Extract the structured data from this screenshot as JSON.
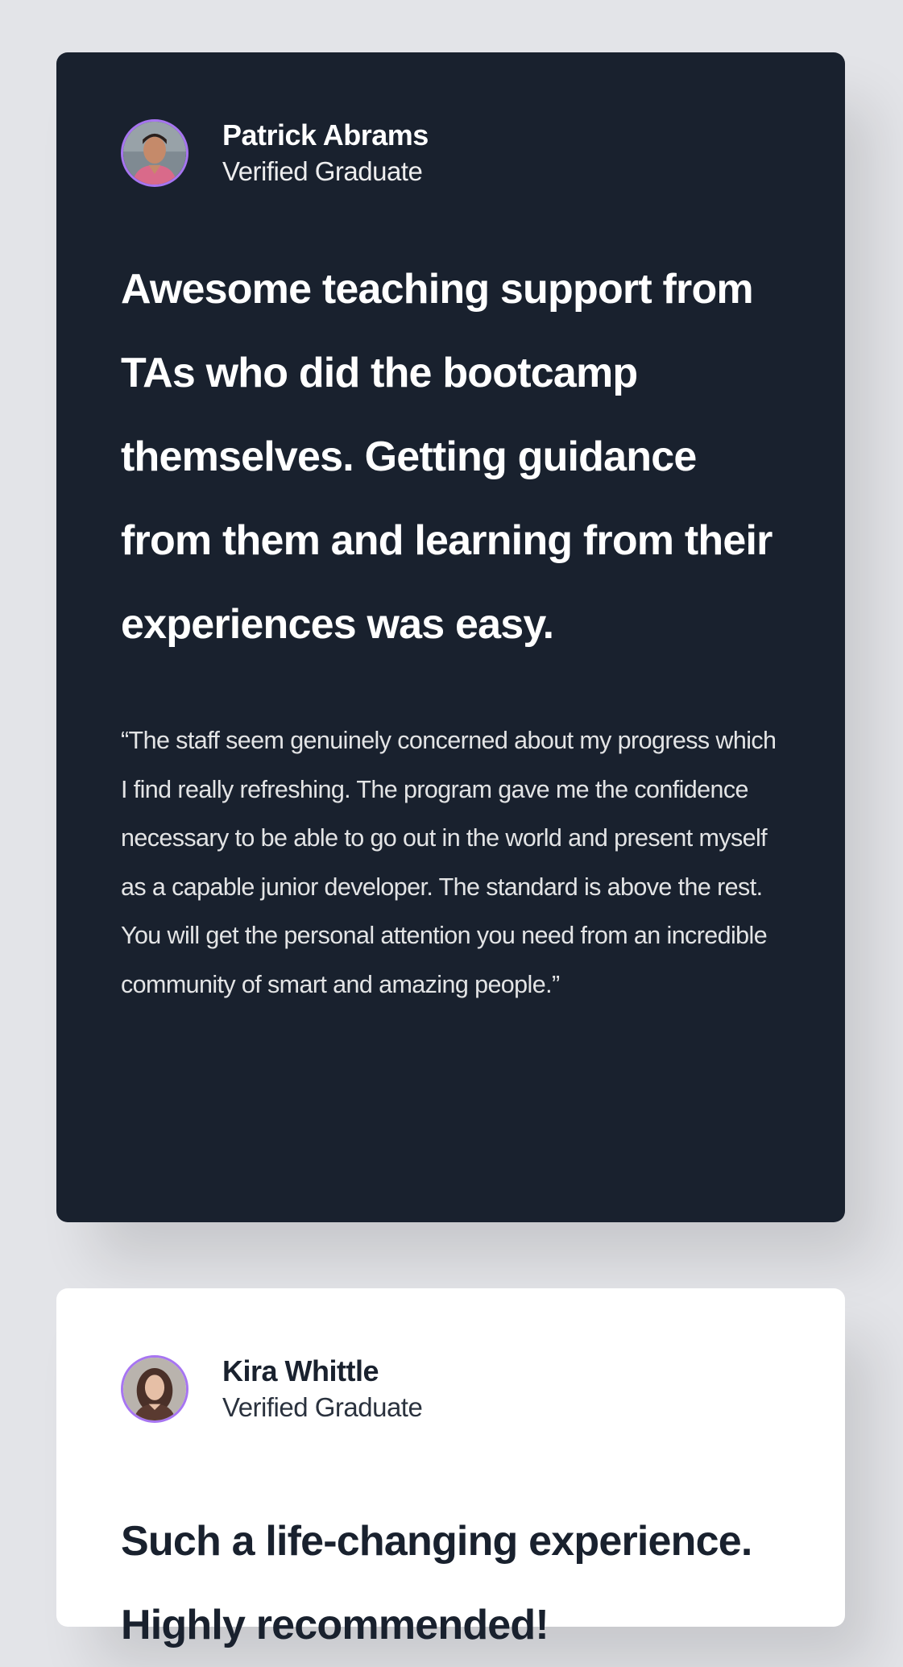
{
  "testimonials": [
    {
      "name": "Patrick Abrams",
      "status": "Verified Graduate",
      "headline": "Awesome teaching support from TAs who did the bootcamp themselves. Getting guidance from them and learning from their experiences was easy.",
      "quote": "“The staff seem genuinely concerned about my progress which I find really refreshing. The program gave me the confidence necessary to be able to go out in the world and present myself as a capable junior developer. The standard is above the rest. You will get the personal attention you need from an incredible community of smart and amazing people.”",
      "card_color": "#19212e"
    },
    {
      "name": "Kira Whittle",
      "status": "Verified Graduate",
      "headline": "Such a life-changing experience. Highly recommended!",
      "card_color": "#ffffff"
    }
  ],
  "colors": {
    "page_background": "#e3e4e8",
    "avatar_border": "#a775f1",
    "dark_text": "#19212e"
  }
}
